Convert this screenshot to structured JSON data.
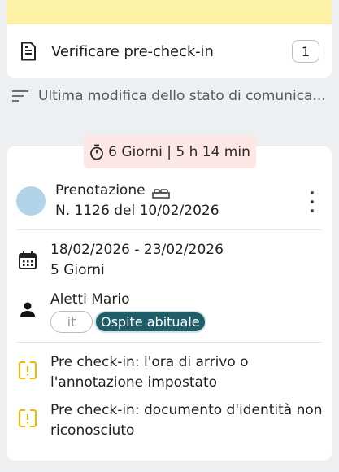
{
  "verify": {
    "label": "Verificare pre-check-in",
    "count": "1"
  },
  "sort": {
    "label": "Ultima modifica dello stato di comunica..."
  },
  "card": {
    "timer": "6 Giorni | 5 h 14 min",
    "booking_title": "Prenotazione",
    "booking_number": "N. 1126 del 10/02/2026",
    "date_range": "18/02/2026 - 23/02/2026",
    "nights": "5 Giorni",
    "guest_name": "Aletti Mario",
    "guest_lang": "it",
    "guest_tag": "Ospite abituale",
    "warnings": [
      "Pre check-in: l'ora di arrivo o l'annotazione impostato",
      "Pre check-in: documento d'identità non riconosciuto"
    ]
  },
  "colors": {
    "yellow_band": "#fdf1a6",
    "timer_bg": "#fce7e5",
    "avatar": "#b1d4e8",
    "guest_tag_bg": "#1f5d69",
    "warning": "#f2b600"
  }
}
